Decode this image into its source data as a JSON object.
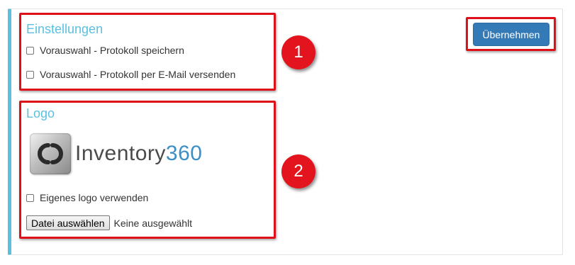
{
  "settings": {
    "heading": "Einstellungen",
    "option1_label": "Vorauswahl - Protokoll speichern",
    "option1_checked": false,
    "option2_label": "Vorauswahl - Protokoll per E-Mail versenden",
    "option2_checked": false
  },
  "logo_section": {
    "heading": "Logo",
    "logo_text_main": "Inventory",
    "logo_text_number": "360",
    "own_logo_label": "Eigenes logo verwenden",
    "own_logo_checked": false,
    "file_button_label": "Datei auswählen",
    "file_status": "Keine ausgewählt"
  },
  "apply_button_label": "Übernehmen",
  "annotations": {
    "badge1": "1",
    "badge2": "2"
  },
  "colors": {
    "accent": "#5bc0de",
    "primary_button": "#337ab7",
    "annotation_red": "#e3141d",
    "logo_number": "#3b8fc4"
  },
  "icons": {
    "logo": "inventory360-logo-icon"
  }
}
